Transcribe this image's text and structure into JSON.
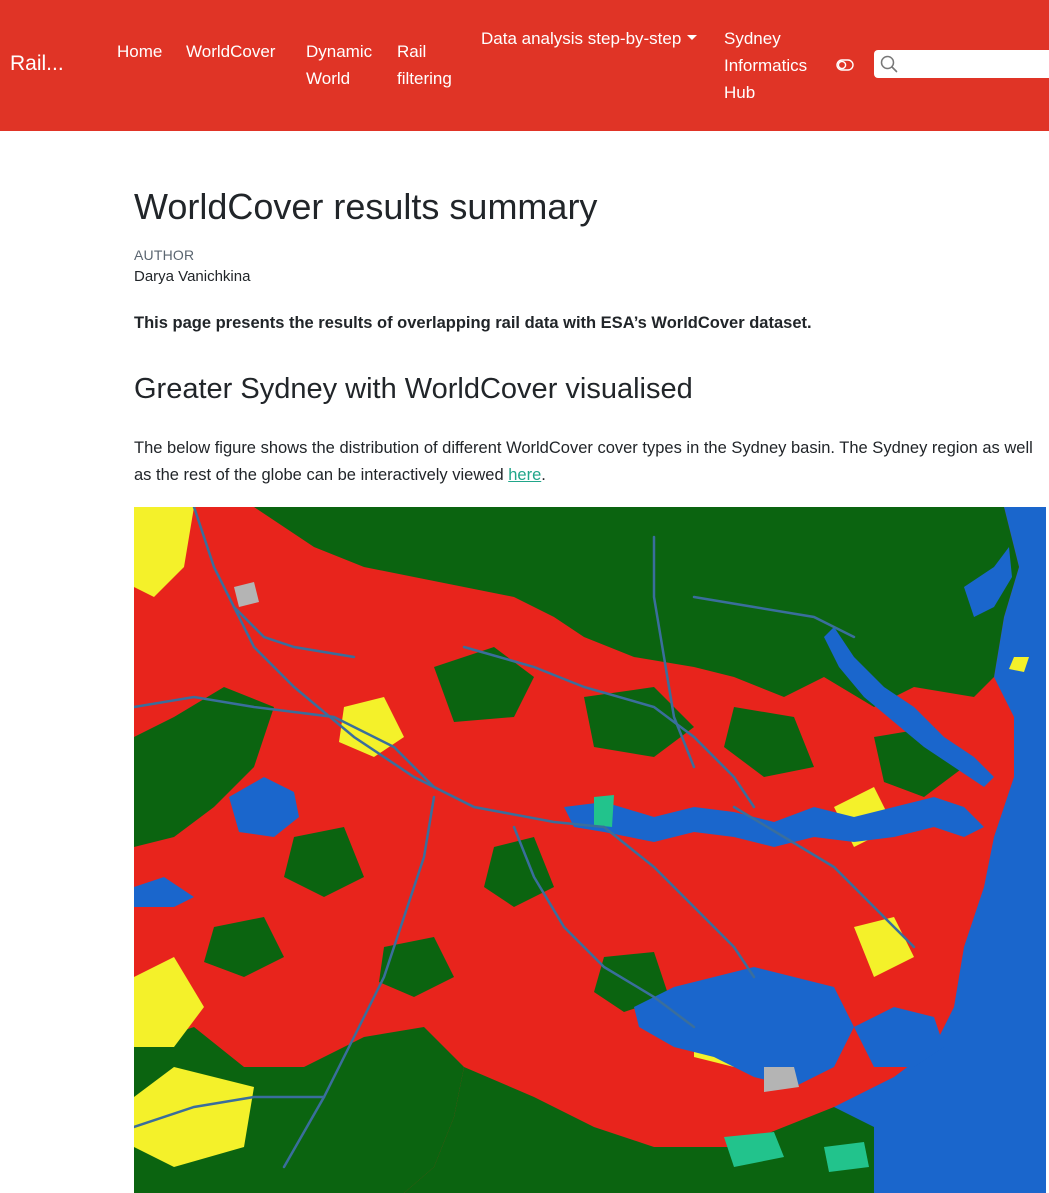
{
  "navbar": {
    "brand": "Rail...",
    "links": {
      "home": "Home",
      "worldcover": "WorldCover",
      "dynamic_world_line1": "Dynamic",
      "dynamic_world_line2": "World",
      "rail_filtering_line1": "Rail",
      "rail_filtering_line2": "filtering",
      "data_analysis": "Data analysis step-by-step",
      "sih_line1": "Sydney",
      "sih_line2": "Informatics",
      "sih_line3": "Hub"
    },
    "search_placeholder": "",
    "background_color": "#e03426",
    "icons": [
      "toggle-icon",
      "search-icon",
      "caret-down-icon"
    ]
  },
  "page": {
    "title": "WorldCover results summary",
    "author_label": "AUTHOR",
    "author_name": "Darya Vanichkina",
    "lead": "This page presents the results of overlapping rail data with ESA’s WorldCover dataset.",
    "section_heading": "Greater Sydney with WorldCover visualised",
    "body_before_link": "The below figure shows the distribution of different WorldCover cover types in the Sydney basin. The Sydney region as well as the rest of the globe can be interactively viewed ",
    "link_text": "here",
    "body_after_link": ".",
    "link_color": "#21a68a"
  },
  "map": {
    "colors": {
      "built_up": "#e8241c",
      "tree_cover": "#0b6410",
      "cropland": "#f4f12a",
      "water": "#1a66cc",
      "bare": "#b4b4b4",
      "wetland": "#22c38c",
      "rail": "#3a6e9c"
    }
  }
}
